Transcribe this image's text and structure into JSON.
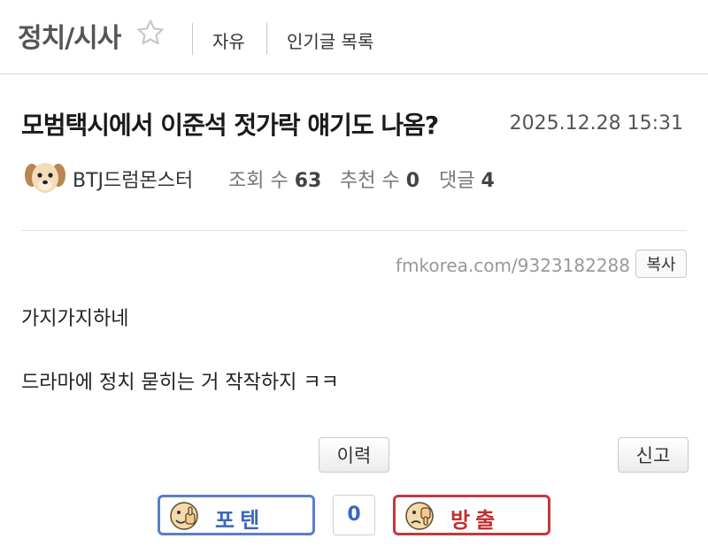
{
  "header": {
    "board_title": "정치/시사",
    "tabs": [
      {
        "label": "자유"
      },
      {
        "label": "인기글 목록"
      }
    ]
  },
  "post": {
    "title": "모범택시에서 이준석 젓가락 얘기도 나옴?",
    "date": "2025.12.28 15:31",
    "author": "BTJ드럼몬스터",
    "views_label": "조회 수",
    "views": "63",
    "recommend_label": "추천 수",
    "recommend": "0",
    "comments_label": "댓글",
    "comments": "4",
    "url": "fmkorea.com/9323182288",
    "copy_label": "복사",
    "body": [
      "가지가지하네",
      "드라마에 정치 묻히는 거 작작하지 ㅋㅋ"
    ]
  },
  "actions": {
    "history_label": "이력",
    "report_label": "신고",
    "upvote_label": "포텐",
    "vote_count": "0",
    "downvote_label": "방출"
  },
  "colors": {
    "upvote": "#5b7ec9",
    "downvote": "#c33b3b",
    "divider": "#d4d4d4"
  }
}
